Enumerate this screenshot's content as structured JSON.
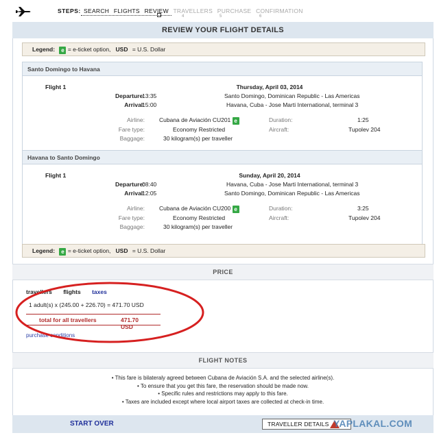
{
  "steps": {
    "label": "STEPS:",
    "items": [
      "SEARCH",
      "FLIGHTS",
      "REVIEW",
      "TRAVELLERS",
      "PURCHASE",
      "CONFIRMATION"
    ],
    "numbers": [
      "4",
      "5",
      "6"
    ]
  },
  "title": "REVIEW YOUR FLIGHT DETAILS",
  "legend": {
    "label": "Legend:",
    "e_badge": "e",
    "e_text": "= e-ticket option,",
    "usd_label": "USD",
    "usd_text": "= U.S. Dollar"
  },
  "flights": [
    {
      "route": "Santo Domingo to Havana",
      "flight_label": "Flight 1",
      "date": "Thursday, April 03, 2014",
      "departure_label": "Departure:",
      "departure_time": "13:35",
      "departure_place": "Santo Domingo, Dominican Republic - Las Americas",
      "arrival_label": "Arrival:",
      "arrival_time": "15:00",
      "arrival_place": "Havana, Cuba - Jose Marti International, terminal 3",
      "airline_label": "Airline:",
      "airline": "Cubana de Aviación CU201",
      "fare_label": "Fare type:",
      "fare": "Economy Restricted",
      "baggage_label": "Baggage:",
      "baggage": "30 kilogram(s) per traveller",
      "duration_label": "Duration:",
      "duration": "1:25",
      "aircraft_label": "Aircraft:",
      "aircraft": "Tupolev 204"
    },
    {
      "route": "Havana to Santo Domingo",
      "flight_label": "Flight 1",
      "date": "Sunday, April 20, 2014",
      "departure_label": "Departure:",
      "departure_time": "08:40",
      "departure_place": "Havana, Cuba - Jose Marti International, terminal 3",
      "arrival_label": "Arrival:",
      "arrival_time": "12:05",
      "arrival_place": "Santo Domingo, Dominican Republic - Las Americas",
      "airline_label": "Airline:",
      "airline": "Cubana de Aviación CU200",
      "fare_label": "Fare type:",
      "fare": "Economy Restricted",
      "baggage_label": "Baggage:",
      "baggage": "30 kilogram(s) per traveller",
      "duration_label": "Duration:",
      "duration": "3:25",
      "aircraft_label": "Aircraft:",
      "aircraft": "Tupolev 204"
    }
  ],
  "price": {
    "header": "PRICE",
    "tabs": [
      "travellers",
      "flights",
      "taxes"
    ],
    "line": "1 adult(s)  x  (245.00  +  226.70)  =  471.70 USD",
    "total_label": "total for all travellers",
    "total_value": "471.70 USD",
    "purchase_conditions": "purchase conditions"
  },
  "notes": {
    "header": "FLIGHT NOTES",
    "items": [
      "• This fare is bilateraly agreed between Cubana de Aviación S.A. and the selected airline(s).",
      "• To ensure that you get this fare, the reservation should be made now.",
      "• Specific rules and restrictions may apply to this fare.",
      "• Taxes are included except where local airport taxes are collected at check-in time."
    ]
  },
  "footer": {
    "start_over": "START OVER",
    "traveller_details": "TRAVELLER DETAILS",
    "watermark": "YAPLAKAL.COM"
  },
  "colors": {
    "accent_blue": "#1f2f9a",
    "total_red": "#b02a2a",
    "eticket_green": "#35a845",
    "header_bg": "#dde6ef"
  }
}
